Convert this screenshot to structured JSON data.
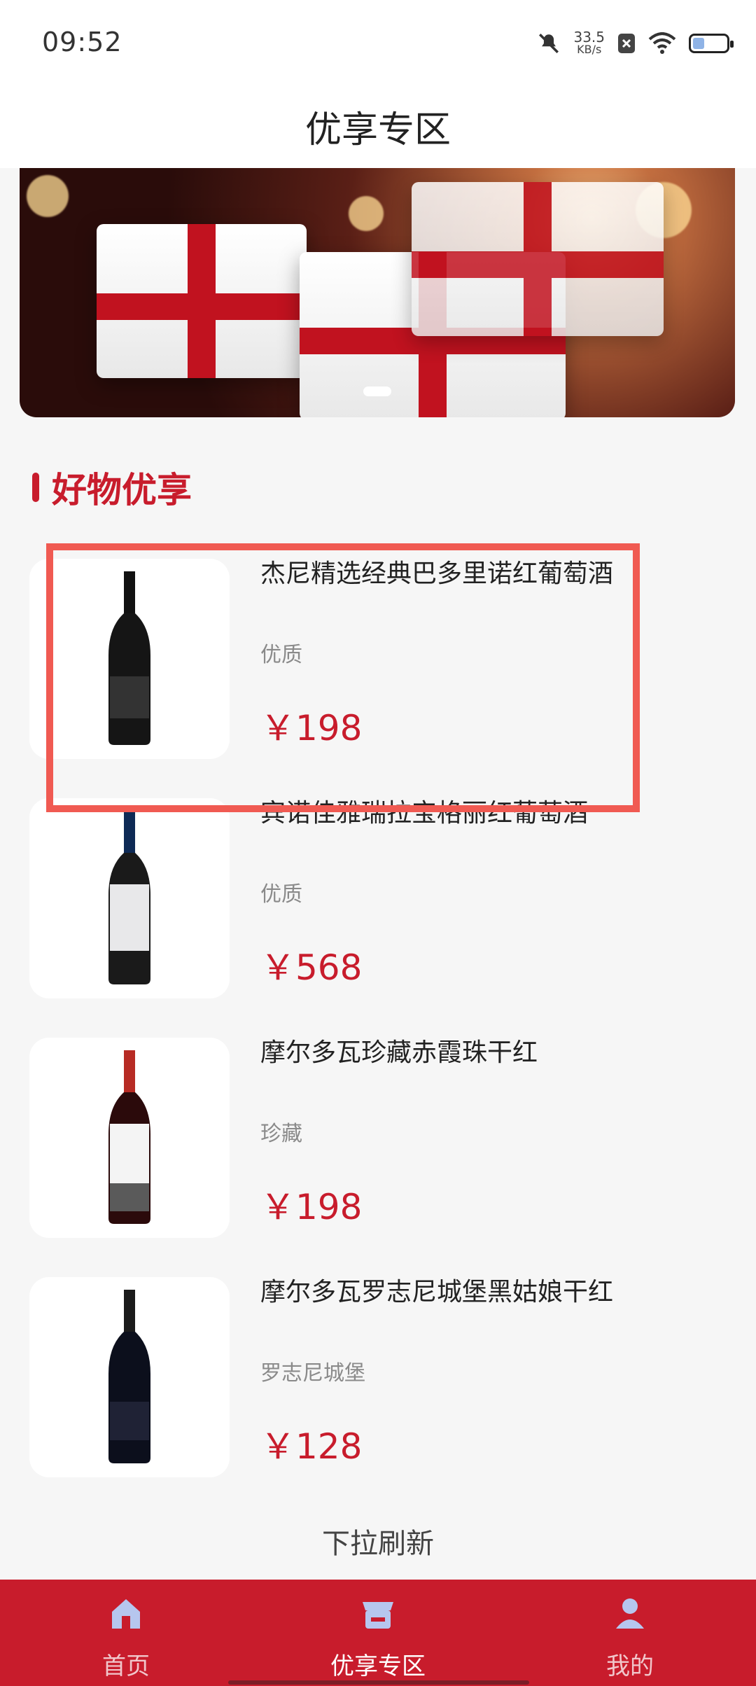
{
  "status": {
    "time": "09:52",
    "net_speed": "33.5",
    "net_unit": "KB/s",
    "battery_level": 0.35
  },
  "header": {
    "title": "优享专区"
  },
  "banner": {
    "indicator": "slide-1-of-1"
  },
  "section": {
    "title": "好物优享"
  },
  "products": [
    {
      "name": "杰尼精选经典巴多里诺红葡萄酒",
      "tag": "优质",
      "price": "￥198"
    },
    {
      "name": "宾诺佳雅瑞拉宝格丽红葡萄酒",
      "tag": "优质",
      "price": "￥568"
    },
    {
      "name": "摩尔多瓦珍藏赤霞珠干红",
      "tag": "珍藏",
      "price": "￥198"
    },
    {
      "name": "摩尔多瓦罗志尼城堡黑姑娘干红",
      "tag": "罗志尼城堡",
      "price": "￥128"
    }
  ],
  "refresh_text": "下拉刷新",
  "nav": {
    "home": "首页",
    "featured": "优享专区",
    "mine": "我的"
  },
  "colors": {
    "accent": "#c81c2c",
    "highlight": "#f05a52"
  },
  "icons": [
    "mute-icon",
    "close-badge-icon",
    "wifi-icon",
    "battery-icon",
    "home-icon",
    "store-icon",
    "user-icon"
  ]
}
